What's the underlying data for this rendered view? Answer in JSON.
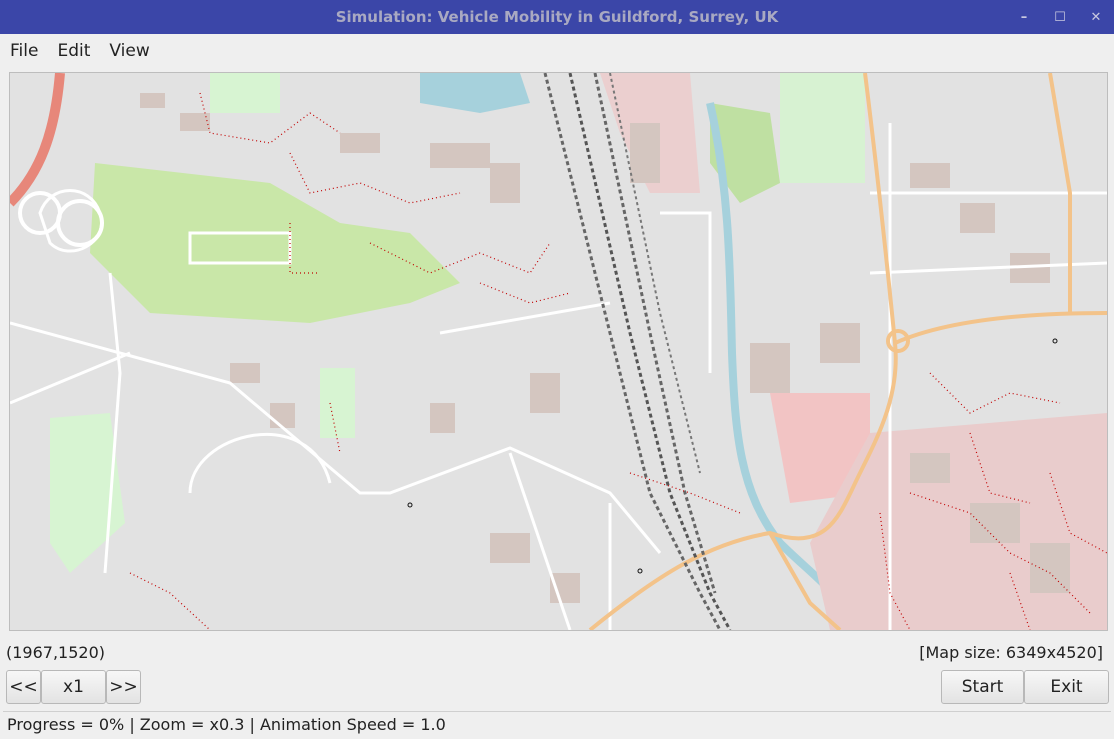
{
  "window": {
    "title": "Simulation: Vehicle Mobility in Guildford, Surrey, UK",
    "controls": {
      "minimize": "–",
      "maximize": "☐",
      "close": "✕"
    }
  },
  "menu": {
    "file": "File",
    "edit": "Edit",
    "view": "View"
  },
  "map": {
    "description_colors": {
      "background": "#e2e2e2",
      "road": "#ffffff",
      "main_road": "#f4c48c",
      "park": "#c9e7a8",
      "water": "#a6d1dc",
      "building": "#d6c8c2",
      "vehicles": "#c20000"
    }
  },
  "status": {
    "coordinates": "(1967,1520)",
    "map_size": "[Map size: 6349x4520]",
    "text": "Progress = 0% | Zoom = x0.3 | Animation Speed = 1.0"
  },
  "controls": {
    "slower": "<<",
    "speed": "x1",
    "faster": ">>",
    "start": "Start",
    "exit": "Exit"
  }
}
